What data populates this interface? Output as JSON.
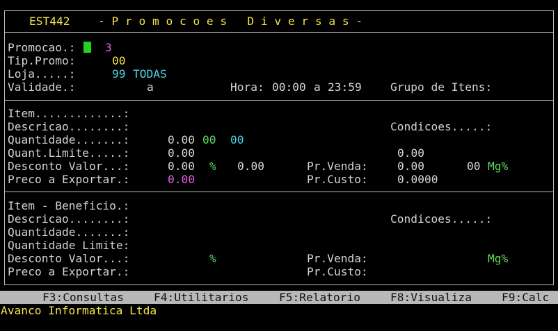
{
  "header": {
    "program_code": "EST442",
    "title": "- P r o m o c o e s   D i v e r s a s -"
  },
  "params": {
    "promocao_label": "Promocao.:",
    "promocao_value": "3",
    "tip_promo_label": "Tip.Promo:",
    "tip_promo_value": "00",
    "loja_label": "Loja.....:",
    "loja_code": "99",
    "loja_name": "TODAS",
    "validade_label": "Validade.:",
    "validade_sep": "a",
    "hora_label": "Hora:",
    "hora_inicio": "00:00",
    "hora_sep": "a",
    "hora_fim": "23:59",
    "grupo_label": "Grupo de Itens:"
  },
  "item": {
    "item_label": "Item.............:",
    "descricao_label": "Descricao........:",
    "condicoes_label": "Condicoes.....:",
    "quantidade_label": "Quantidade.......:",
    "quantidade_value": "0.00",
    "quantidade_code1": "00",
    "quantidade_code2": "00",
    "quant_limite_label": "Quant.Limite.....:",
    "quant_limite_value": "0.00",
    "cond_value": "0.00",
    "desconto_label": "Desconto Valor...:",
    "desconto_value": "0.00",
    "desconto_pct_sign": "%",
    "desconto_pct_value": "0.00",
    "pr_venda_label": "Pr.Venda:",
    "pr_venda_value": "0.00",
    "mg_code": "00",
    "mg_label": "Mg%",
    "preco_exportar_label": "Preco a Exportar.:",
    "preco_exportar_value": "0.00",
    "pr_custo_label": "Pr.Custo:",
    "pr_custo_value": "0.0000"
  },
  "beneficio": {
    "item_label": "Item - Beneficio.:",
    "descricao_label": "Descricao........:",
    "condicoes_label": "Condicoes.....:",
    "quantidade_label": "Quantidade.......:",
    "quantidade_limite_label": "Quantidade Limite:",
    "desconto_label": "Desconto Valor...:",
    "desconto_pct_sign": "%",
    "pr_venda_label": "Pr.Venda:",
    "mg_label": "Mg%",
    "preco_exportar_label": "Preco a Exportar.:",
    "pr_custo_label": "Pr.Custo:"
  },
  "function_keys": [
    {
      "label": "F3:Consultas"
    },
    {
      "label": "F4:Utilitarios"
    },
    {
      "label": "F5:Relatorio"
    },
    {
      "label": "F8:Visualiza"
    },
    {
      "label": "F9:Calc"
    }
  ],
  "footer": {
    "company": "Avanco Informatica Ltda"
  },
  "colors": {
    "background": "#000000",
    "label": "#d3d3d3",
    "title": "#f5e44a",
    "value_magenta": "#e063e0",
    "value_cyan": "#4fd3e6",
    "value_green": "#5fdc5f",
    "cursor": "#22d322",
    "fkey_bar": "#b8b8b8"
  }
}
